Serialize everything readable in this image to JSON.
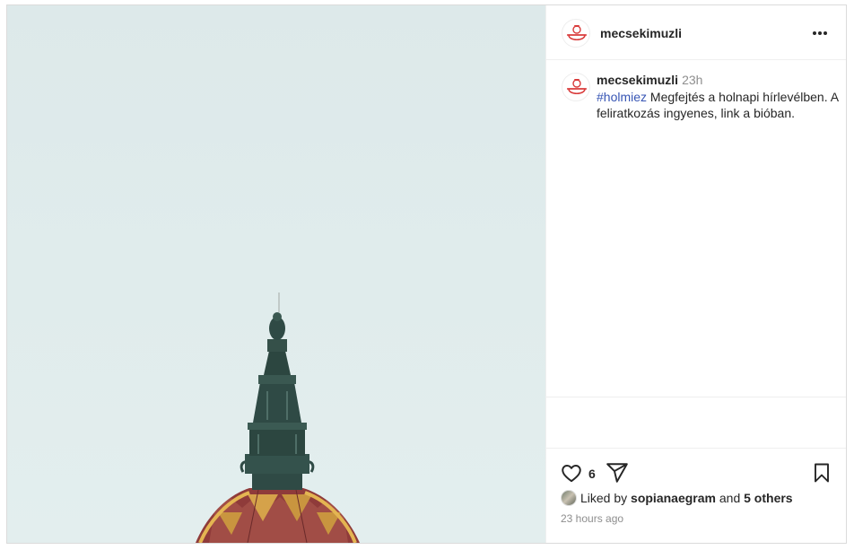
{
  "post": {
    "username": "mecsekimuzli",
    "time_short": "23h",
    "hashtag": "#holmiez",
    "caption_text": " Megfejtés a holnapi hírlevélben. A feliratkozás ingyenes, link a bióban.",
    "like_count": "6",
    "liked_by_prefix": "Liked by ",
    "liked_by_user": "sopianaegram",
    "liked_by_and": " and ",
    "liked_by_others": "5 others",
    "timestamp": "23 hours ago"
  },
  "icons": {
    "more": "more-options-icon",
    "like": "heart-icon",
    "share": "share-icon",
    "save": "bookmark-icon"
  },
  "colors": {
    "hashtag": "#3755b4",
    "sky": "#dde9ea",
    "dome": "#8f3b3a",
    "spire": "#2f4a45"
  }
}
